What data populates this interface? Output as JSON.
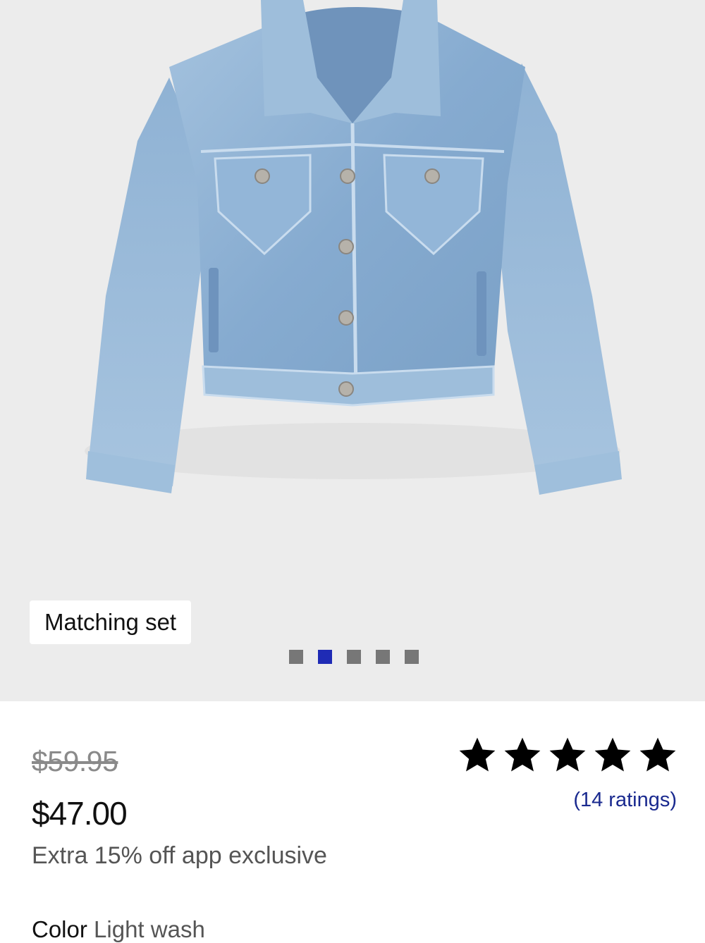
{
  "gallery": {
    "badge_label": "Matching set",
    "dots_count": 5,
    "active_dot_index": 1,
    "product_image_icon": "denim-jacket-icon"
  },
  "pricing": {
    "original_price": "$59.95",
    "sale_price": "$47.00",
    "promo_text": "Extra 15% off app exclusive"
  },
  "rating": {
    "stars": 5,
    "ratings_text": "(14 ratings)"
  },
  "color": {
    "label": "Color",
    "value": "Light wash"
  },
  "colors": {
    "active_dot": "#1f2bb5",
    "inactive_dot": "#777777",
    "ratings_link": "#1a2a8f",
    "gallery_bg": "#ececec",
    "denim": "#8fb3d6"
  }
}
